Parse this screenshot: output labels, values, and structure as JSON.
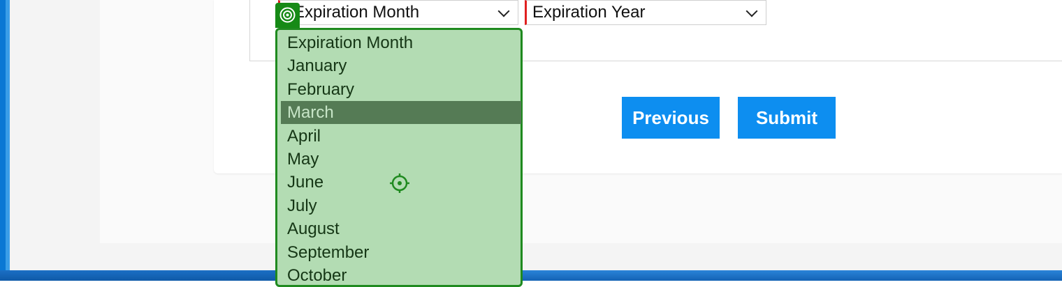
{
  "form": {
    "expiration_month": {
      "value": "Expiration Month"
    },
    "expiration_year": {
      "value": "Expiration Year"
    },
    "previous_label": "Previous",
    "submit_label": "Submit"
  },
  "dropdown": {
    "options": [
      "Expiration Month",
      "January",
      "February",
      "March",
      "April",
      "May",
      "June",
      "July",
      "August",
      "September",
      "October"
    ],
    "highlighted": "March"
  },
  "colors": {
    "primary_button": "#0d8ef0",
    "dropdown_bg": "#b3dcb3",
    "dropdown_border": "#1f8a1f",
    "highlight_bg": "#557b55",
    "required_marker": "#e02020"
  },
  "icons": {
    "badge": "target-icon",
    "cursor": "crosshair-icon"
  }
}
